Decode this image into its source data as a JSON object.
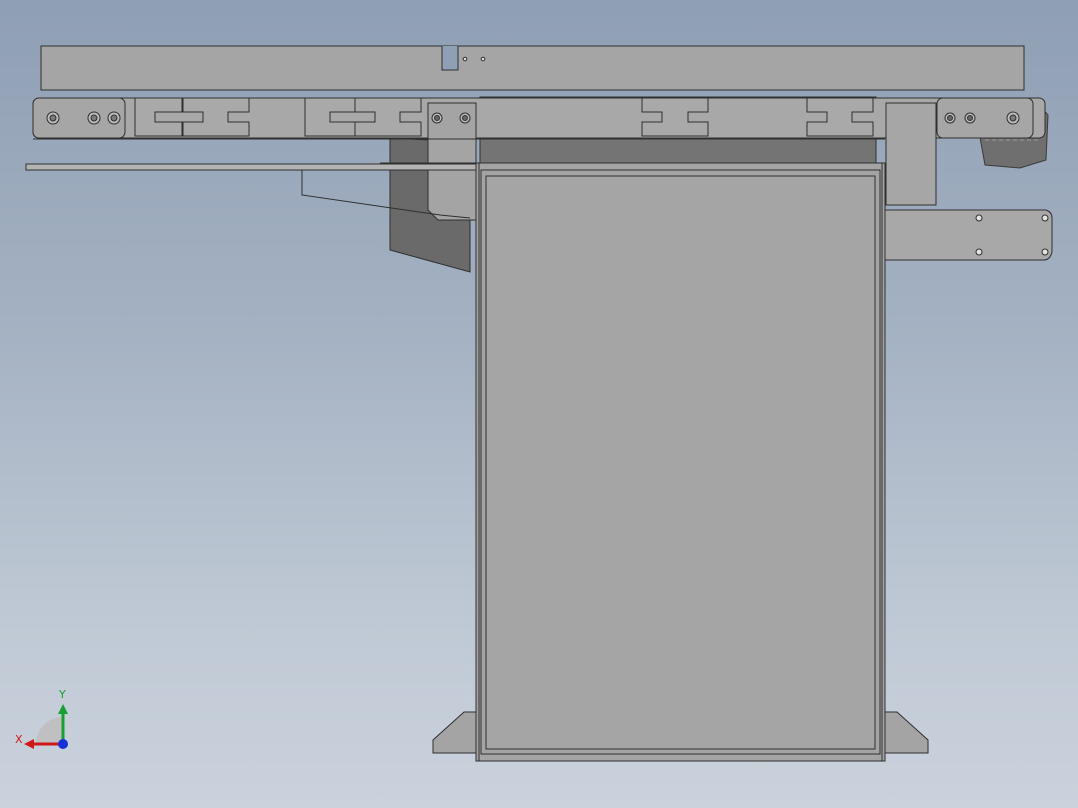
{
  "view": {
    "background_top": "#8f9fb4",
    "background_bottom": "#cad2dc",
    "part_fill": "#a2a2a2",
    "part_fill_light": "#a9a9a9",
    "part_fill_dark": "#747474",
    "edge_color": "#2f2f2f"
  },
  "triad": {
    "x_label": "X",
    "y_label": "Y",
    "x_color": "#d01818",
    "y_color": "#16a030",
    "z_color": "#1830d8"
  }
}
